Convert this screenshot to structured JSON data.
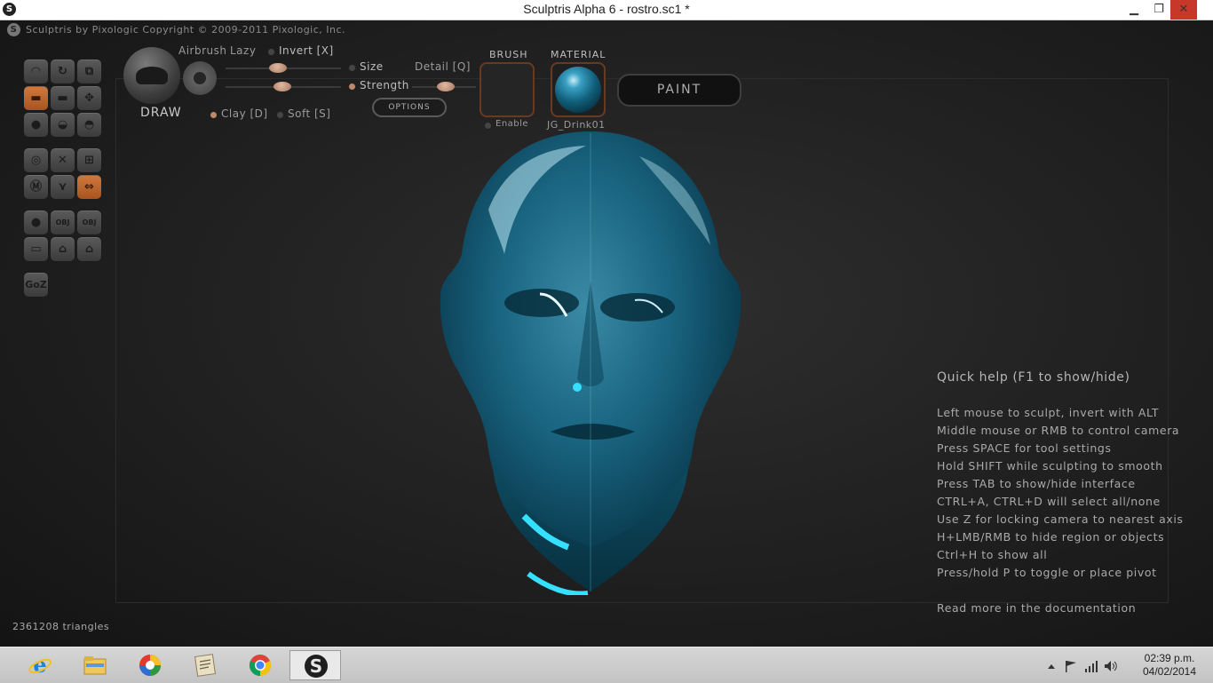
{
  "window": {
    "title": "Sculptris Alpha 6 - rostro.sc1 *",
    "minimize": "▁",
    "restore": "❐",
    "close": "✕"
  },
  "header": {
    "copyright": "Sculptris by Pixologic    Copyright © 2009-2011 Pixologic, Inc."
  },
  "toolbar": {
    "tool_name": "DRAW",
    "airbrush_label": "Airbrush",
    "lazy_label": "Lazy",
    "invert_label": "Invert [X]",
    "size_label": "Size",
    "detail_label": "Detail [Q]",
    "strength_label": "Strength",
    "clay_label": "Clay [D]",
    "soft_label": "Soft [S]",
    "options_label": "OPTIONS",
    "brush_label": "BRUSH",
    "enable_label": "Enable",
    "material_label": "MATERIAL",
    "material_name": "JG_Drink01",
    "paint_label": "PAINT"
  },
  "sliders": {
    "lazy": 0.48,
    "size": 0.52,
    "detail": 0.5
  },
  "tools": {
    "goz_label": "GoZ",
    "active": [
      "draw",
      "symmetry"
    ]
  },
  "status": {
    "triangles": "2361208 triangles"
  },
  "quick_help": {
    "title": "Quick help (F1 to show/hide)",
    "lines": [
      "Left mouse to sculpt, invert with ALT",
      "Middle mouse or RMB to control camera",
      "Press SPACE for tool settings",
      "Hold SHIFT while sculpting to smooth",
      "Press TAB to show/hide interface",
      "CTRL+A, CTRL+D will select all/none",
      "Use Z for locking camera to nearest axis",
      "H+LMB/RMB to hide region or objects",
      "Ctrl+H to show all",
      "Press/hold P to toggle or place pivot"
    ],
    "doc_link": "Read more in the documentation"
  },
  "taskbar": {
    "apps": [
      "internet-explorer",
      "file-explorer",
      "color-app",
      "notepad-app",
      "chrome",
      "sculptris"
    ],
    "time": "02:39 p.m.",
    "date": "04/02/2014"
  },
  "colors": {
    "accent_orange": "#c0652a",
    "head_blue": "#1d6e8a",
    "highlight_cyan": "#35e0ff"
  }
}
